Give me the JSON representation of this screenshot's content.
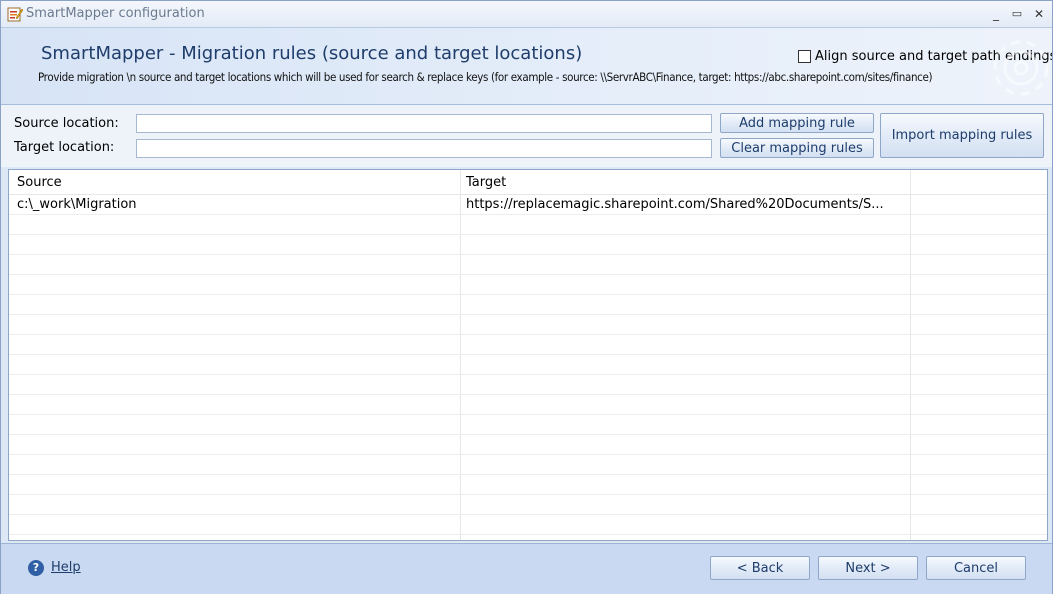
{
  "window": {
    "title": "SmartMapper configuration",
    "minimize_glyph": "_",
    "maximize_glyph": "▭",
    "close_glyph": "✕"
  },
  "header": {
    "title": "SmartMapper - Migration rules (source and target locations)",
    "description": "Provide migration \\n source and target locations which will be used for search & replace keys (for example - source: \\\\ServrABC\\Finance, target: https://abc.sharepoint.com/sites/finance)",
    "align_label": "Align source and target path endings",
    "align_checked": false
  },
  "form": {
    "source_label": "Source location:",
    "source_value": "",
    "target_label": "Target location:",
    "target_value": "",
    "add_button": "Add mapping rule",
    "clear_button": "Clear mapping rules",
    "import_button": "Import mapping rules"
  },
  "grid": {
    "columns": [
      "Source",
      "Target"
    ],
    "rows": [
      {
        "source": "c:\\_work\\Migration",
        "target": "https://replacemagic.sharepoint.com/Shared%20Documents/S..."
      }
    ]
  },
  "footer": {
    "help_label": "Help",
    "back_button": "<   Back",
    "next_button": "Next   >",
    "cancel_button": "Cancel"
  },
  "colors": {
    "accent": "#1e3d6b",
    "window_bg": "#c9d9f1",
    "border": "#8ea7c9"
  },
  "icons": {
    "app": "smartmapper-app-icon",
    "help": "help-icon",
    "decoration": "gear-icon"
  }
}
